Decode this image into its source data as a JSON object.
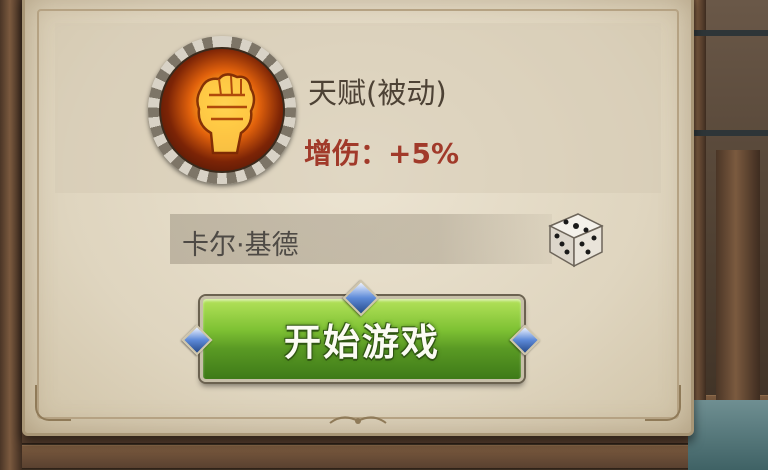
{
  "hero": {
    "talent_label": "天赋(被动)",
    "damage_bonus": "增伤：+5%",
    "skill_icon": "flaming-fist-icon"
  },
  "name_field": {
    "value": "卡尔·基德",
    "randomize_icon": "dice-icon"
  },
  "start_button": {
    "label": "开始游戏"
  },
  "colors": {
    "talent_text": "#4d4235",
    "bonus_text": "#a13a2a",
    "button_green": "#7fc234",
    "parchment": "#dfd5bf"
  }
}
